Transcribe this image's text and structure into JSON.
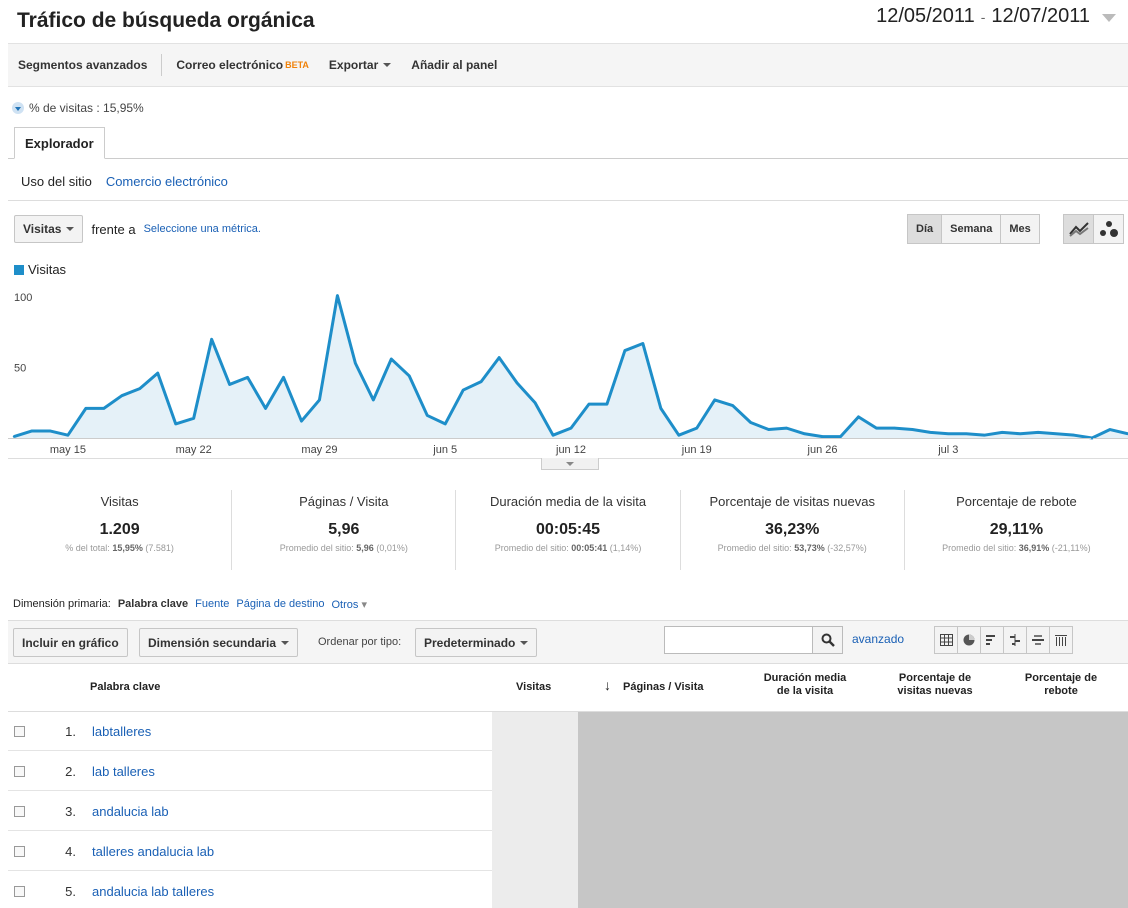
{
  "header": {
    "title": "Tráfico de búsqueda orgánica",
    "date_start": "12/05/2011",
    "date_sep": "-",
    "date_end": "12/07/2011"
  },
  "toolbar": {
    "segments": "Segmentos avanzados",
    "email": "Correo electrónico",
    "beta": "BETA",
    "export": "Exportar",
    "add_panel": "Añadir al panel"
  },
  "segment": {
    "label": "% de visitas : 15,95%"
  },
  "tabs": {
    "explorer": "Explorador"
  },
  "subnav": {
    "site_usage": "Uso del sitio",
    "ecommerce": "Comercio electrónico"
  },
  "metric": {
    "selected": "Visitas",
    "versus": "frente a",
    "select_link": "Seleccione una métrica."
  },
  "period": {
    "day": "Día",
    "week": "Semana",
    "month": "Mes"
  },
  "chart_data": {
    "type": "area",
    "legend": "Visitas",
    "y_ticks": [
      "100",
      "50"
    ],
    "ylim": [
      0,
      110
    ],
    "grid": false,
    "x_ticks": [
      "may 15",
      "may 22",
      "may 29",
      "jun 5",
      "jun 12",
      "jun 19",
      "jun 26",
      "jul 3"
    ],
    "x_tick_index": [
      3,
      10,
      17,
      24,
      31,
      38,
      45,
      52
    ],
    "series": [
      {
        "name": "Visitas",
        "color": "#1e8ec9",
        "values": [
          1,
          5,
          5,
          2,
          21,
          21,
          30,
          35,
          46,
          10,
          14,
          70,
          38,
          43,
          21,
          43,
          12,
          27,
          101,
          53,
          27,
          56,
          44,
          16,
          10,
          34,
          40,
          57,
          39,
          25,
          2,
          7,
          24,
          24,
          62,
          67,
          21,
          2,
          7,
          27,
          23,
          11,
          6,
          7,
          3,
          1,
          1,
          15,
          7,
          7,
          6,
          4,
          3,
          3,
          2,
          4,
          3,
          4,
          3,
          2,
          0,
          6,
          3
        ]
      }
    ]
  },
  "metrics": [
    {
      "label": "Visitas",
      "value": "1.209",
      "sub_prefix": "% del total:",
      "sub_bold": "15,95%",
      "sub_suffix": "(7.581)"
    },
    {
      "label": "Páginas / Visita",
      "value": "5,96",
      "sub_prefix": "Promedio del sitio:",
      "sub_bold": "5,96",
      "sub_suffix": "(0,01%)"
    },
    {
      "label": "Duración media de la visita",
      "value": "00:05:45",
      "sub_prefix": "Promedio del sitio:",
      "sub_bold": "00:05:41",
      "sub_suffix": "(1,14%)"
    },
    {
      "label": "Porcentaje de visitas nuevas",
      "value": "36,23%",
      "sub_prefix": "Promedio del sitio:",
      "sub_bold": "53,73%",
      "sub_suffix": "(-32,57%)"
    },
    {
      "label": "Porcentaje de rebote",
      "value": "29,11%",
      "sub_prefix": "Promedio del sitio:",
      "sub_bold": "36,91%",
      "sub_suffix": "(-21,11%)"
    }
  ],
  "dimensions": {
    "label": "Dimensión primaria:",
    "current": "Palabra clave",
    "source": "Fuente",
    "landing": "Página de destino",
    "others": "Otros"
  },
  "table_controls": {
    "plot": "Incluir en gráfico",
    "secondary": "Dimensión secundaria",
    "sort_label": "Ordenar por tipo:",
    "sort_value": "Predeterminado",
    "advanced": "avanzado",
    "search_value": ""
  },
  "table": {
    "headers": {
      "keyword": "Palabra clave",
      "visits": "Visitas",
      "pages": "Páginas / Visita",
      "duration_1": "Duración media",
      "duration_2": "de la visita",
      "new_1": "Porcentaje de",
      "new_2": "visitas nuevas",
      "bounce_1": "Porcentaje de",
      "bounce_2": "rebote"
    },
    "rows": [
      {
        "num": "1.",
        "keyword": "labtalleres"
      },
      {
        "num": "2.",
        "keyword": "lab talleres"
      },
      {
        "num": "3.",
        "keyword": "andalucia lab"
      },
      {
        "num": "4.",
        "keyword": "talleres andalucia lab"
      },
      {
        "num": "5.",
        "keyword": "andalucia lab talleres"
      }
    ]
  }
}
